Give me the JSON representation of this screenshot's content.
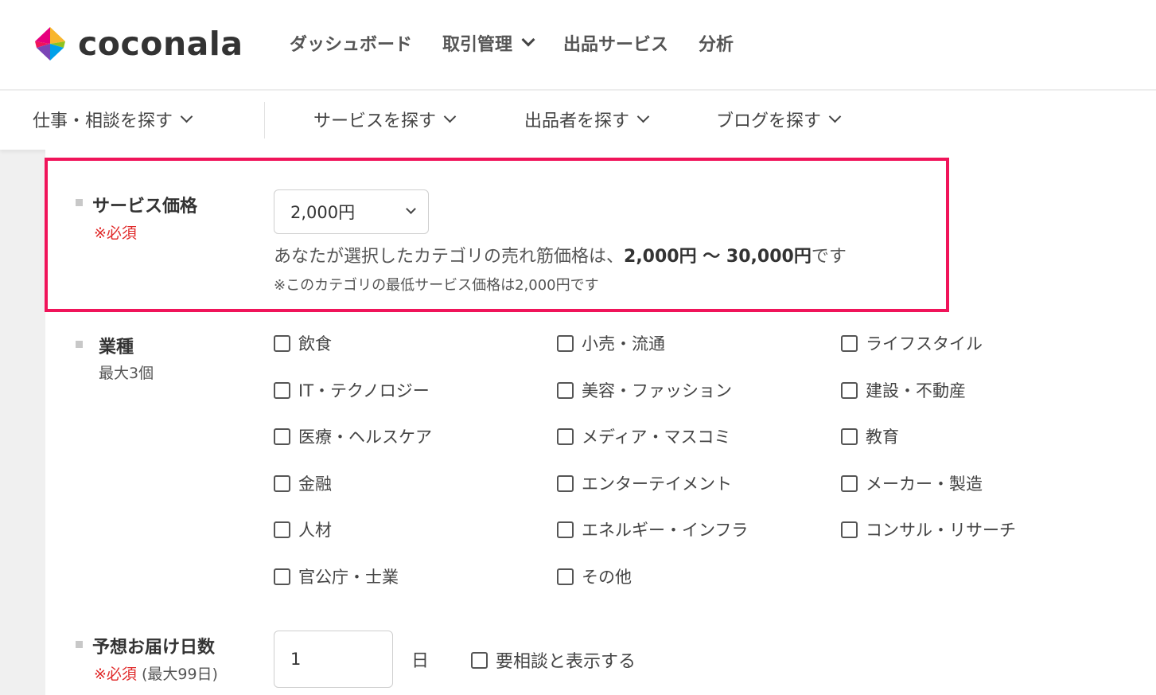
{
  "header": {
    "logo_text": "coconala",
    "nav": [
      {
        "label": "ダッシュボード"
      },
      {
        "label": "取引管理"
      },
      {
        "label": "出品サービス"
      },
      {
        "label": "分析"
      }
    ]
  },
  "subnav": {
    "items": [
      {
        "label": "仕事・相談を探す"
      },
      {
        "label": "サービスを探す"
      },
      {
        "label": "出品者を探す"
      },
      {
        "label": "ブログを探す"
      }
    ]
  },
  "price_section": {
    "label": "サービス価格",
    "required": "※必須",
    "selected_price": "2,000円",
    "note_prefix": "あなたが選択したカテゴリの売れ筋価格は、",
    "note_range": "2,000円 ～ 30,000円",
    "note_suffix": "です",
    "note_min": "※このカテゴリの最低サービス価格は2,000円です",
    "highlight_color": "#f0145a"
  },
  "industry_section": {
    "label": "業種",
    "limit": "最大3個",
    "options": [
      "飲食",
      "小売・流通",
      "ライフスタイル",
      "IT・テクノロジー",
      "美容・ファッション",
      "建設・不動産",
      "医療・ヘルスケア",
      "メディア・マスコミ",
      "教育",
      "金融",
      "エンターテイメント",
      "メーカー・製造",
      "人材",
      "エネルギー・インフラ",
      "コンサル・リサーチ",
      "官公庁・士業",
      "その他"
    ]
  },
  "delivery_section": {
    "label": "予想お届け日数",
    "required": "※必須",
    "max_note": "(最大99日)",
    "days_value": "1",
    "unit": "日",
    "consult_label": "要相談と表示する"
  }
}
